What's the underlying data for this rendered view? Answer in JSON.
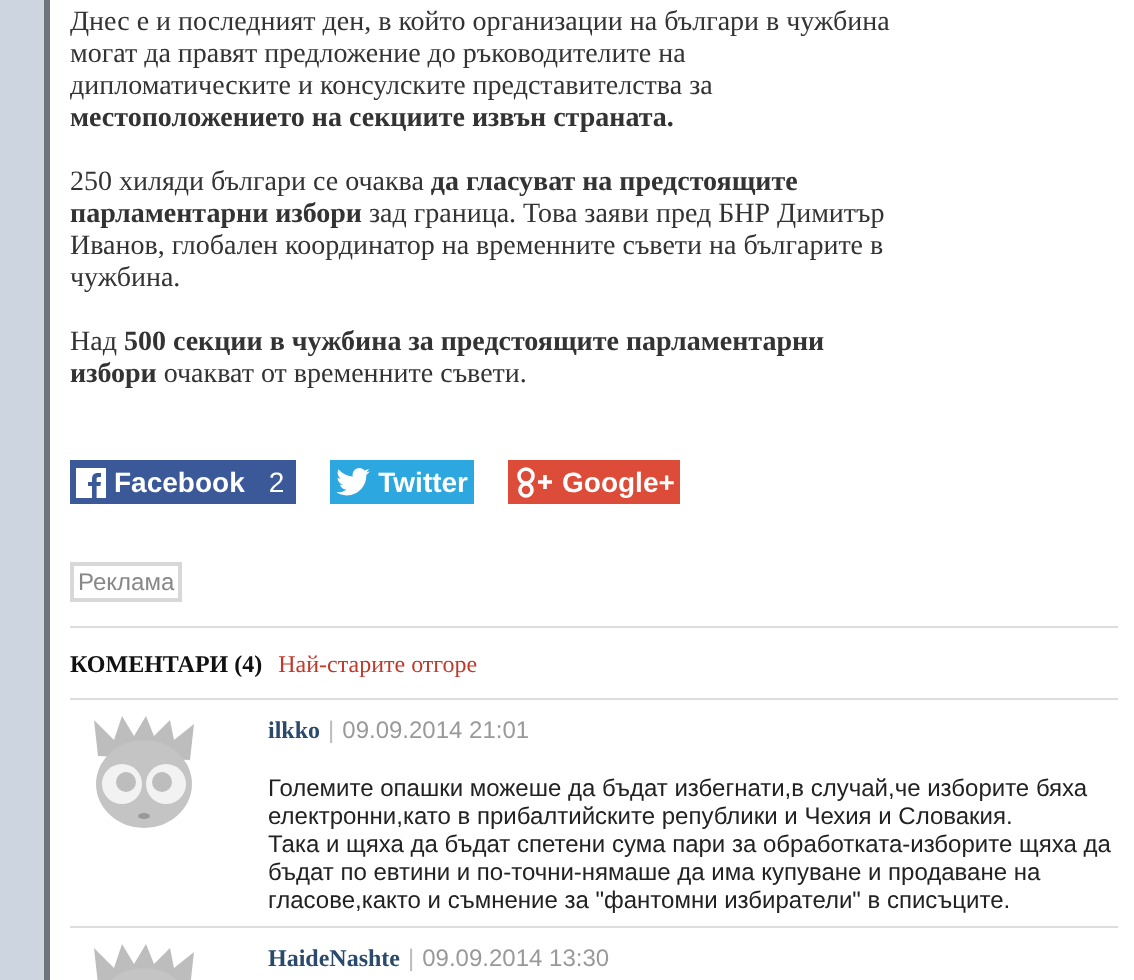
{
  "article": {
    "paragraphs": [
      "Днес е и последният ден, в който организации на българи в чужбина могат да правят предложение до ръководителите на дипломатическите и консулските представителства за **местоположението на секциите извън страната.**",
      "250 хиляди българи се очаква **да гласуват на предстоящите парламентарни избори** зад граница. Това заяви пред БНР Димитър Иванов, глобален координатор на временните съвети на българите в чужбина.",
      "Над **500 секции в чужбина за предстоящите парламентарни избори** очакват от временните съвети."
    ]
  },
  "share_buttons": [
    {
      "kind": "facebook",
      "label": "Facebook",
      "count": "2"
    },
    {
      "kind": "twitter",
      "label": "Twitter"
    },
    {
      "kind": "google",
      "label": "Google+"
    }
  ],
  "ad_label": "Реклама",
  "comments": {
    "title": "КОМЕНТАРИ (4)",
    "sort_link": "Най-старите отгоре",
    "items": [
      {
        "author": "ilkko",
        "separator": "|",
        "date": "09.09.2014 21:01",
        "lines": [
          "Големите опашки можеше да бъдат избегнати,в случай,че изборите бяха електронни,като в прибалтийските републики и Чехия и Словакия.",
          "Така и щяха да бъдат спетени сума пари за обработката-изборите щяха да бъдат по евтини и по-точни-нямаше да има купуване и продаване на гласове,както и съмнение за \"фантомни избиратели\" в списъците."
        ]
      },
      {
        "author": "HaideNashte",
        "separator": "|",
        "date": "09.09.2014 13:30"
      }
    ]
  }
}
